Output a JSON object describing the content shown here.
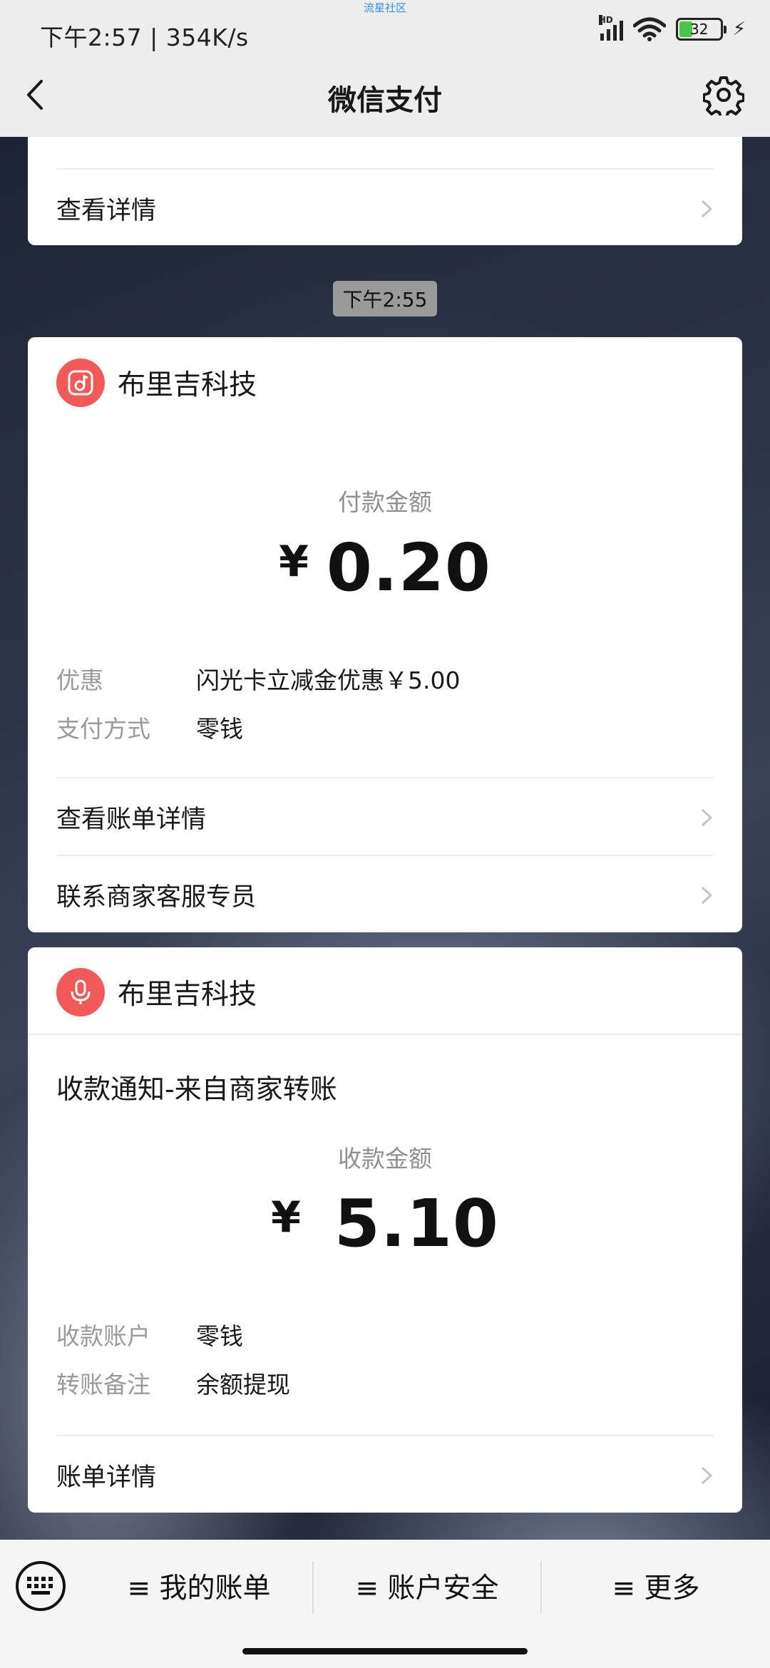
{
  "status_bar": {
    "time_speed": "下午2:57 | 354K/s",
    "center_text": "流星社区",
    "hd": "HD",
    "battery": "32",
    "battery_level": 0.32
  },
  "header": {
    "title": "微信支付"
  },
  "card_top": {
    "link_label": "查看详情"
  },
  "timestamp": "下午2:55",
  "payment_card": {
    "merchant": "布里吉科技",
    "amount_label": "付款金额",
    "currency": "¥",
    "amount": "0.20",
    "details": [
      {
        "key": "优惠",
        "value": "闪光卡立减金优惠￥5.00"
      },
      {
        "key": "支付方式",
        "value": "零钱"
      }
    ],
    "links": [
      "查看账单详情",
      "联系商家客服专员"
    ]
  },
  "receipt_card": {
    "merchant": "布里吉科技",
    "title": "收款通知-来自商家转账",
    "amount_label": "收款金额",
    "currency": "¥",
    "amount": "5.10",
    "details": [
      {
        "key": "收款账户",
        "value": "零钱"
      },
      {
        "key": "转账备注",
        "value": "余额提现"
      }
    ],
    "link": "账单详情"
  },
  "bottom_menu": {
    "items": [
      "≡ 我的账单",
      "≡ 账户安全",
      "≡ 更多"
    ]
  },
  "colors": {
    "merchant_icon": "#f25a5a",
    "battery_fill": "#4cc64a"
  }
}
